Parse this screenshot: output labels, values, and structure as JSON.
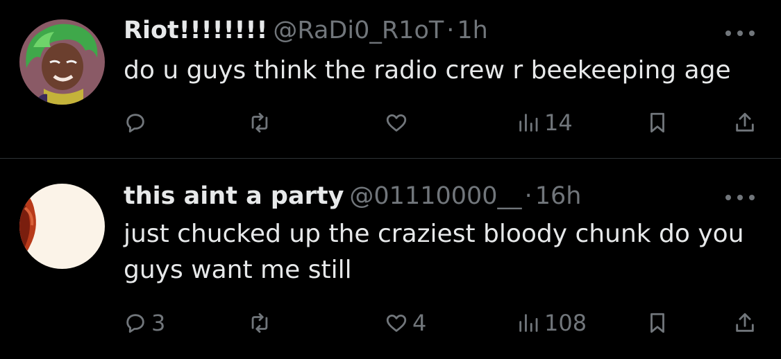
{
  "tweets": [
    {
      "name": "Riot!!!!!!!!",
      "handle": "@RaDi0_R1oT",
      "separator": "·",
      "time": "1h",
      "text": "do u guys think the radio crew r beekeeping age",
      "counts": {
        "replies": "",
        "retweets": "",
        "likes": "",
        "views": "14"
      }
    },
    {
      "name": "this aint a party",
      "handle": "@01110000__",
      "separator": "·",
      "time": "16h",
      "text": "just chucked up the craziest bloody chunk do you guys want me still",
      "counts": {
        "replies": "3",
        "retweets": "",
        "likes": "4",
        "views": "108"
      }
    }
  ],
  "icons": {
    "reply": "reply-icon",
    "retweet": "retweet-icon",
    "like": "heart-icon",
    "views": "views-icon",
    "bookmark": "bookmark-icon",
    "share": "share-icon",
    "more": "more-icon"
  },
  "colors": {
    "background": "#000000",
    "text": "#e7e9ea",
    "secondary": "#71767b",
    "divider": "#2f3336"
  }
}
